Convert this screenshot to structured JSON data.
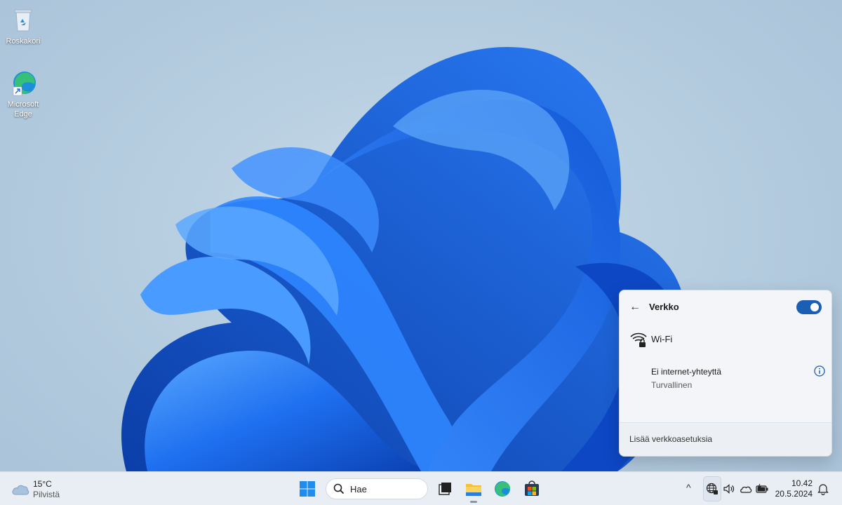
{
  "desktop": {
    "icons": [
      {
        "label": "Roskakori",
        "icon": "recycle-bin-icon"
      },
      {
        "label_line1": "Microsoft",
        "label_line2": "Edge",
        "icon": "edge-icon"
      }
    ]
  },
  "taskbar": {
    "weather": {
      "temp": "15°C",
      "condition": "Pilvistä",
      "icon": "cloud-icon"
    },
    "search": {
      "placeholder": "Hae"
    },
    "apps": [
      "task-view-icon",
      "file-explorer-icon",
      "edge-icon",
      "store-icon"
    ],
    "tray": {
      "chevron": "^",
      "icons": [
        "globe-lock-icon",
        "volume-icon",
        "onedrive-icon",
        "battery-charging-icon"
      ]
    },
    "clock": {
      "time": "10.42",
      "date": "20.5.2024"
    },
    "notifications_icon": "bell-icon"
  },
  "network_flyout": {
    "back": "←",
    "title": "Verkko",
    "toggle_on": true,
    "wifi_label": "Wi-Fi",
    "status_main": "Ei internet-yhteyttä",
    "status_sub": "Turvallinen",
    "more_settings": "Lisää verkkoasetuksia"
  },
  "colors": {
    "accent": "#1a5fb4",
    "wallpaper_bloom": "#1e6ff0",
    "taskbar": "#e9eef4"
  }
}
